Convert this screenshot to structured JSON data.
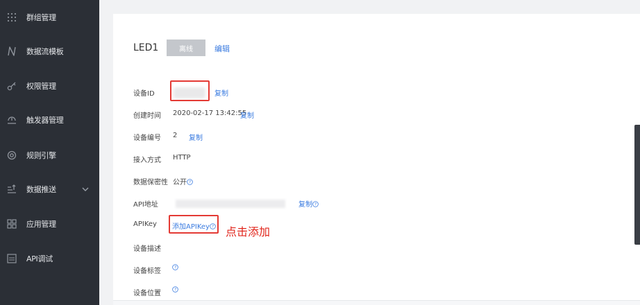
{
  "sidebar": {
    "items": [
      {
        "label": "群组管理",
        "icon": "grid-icon"
      },
      {
        "label": "数据流模板",
        "icon": "flow-n-icon"
      },
      {
        "label": "权限管理",
        "icon": "key-icon"
      },
      {
        "label": "触发器管理",
        "icon": "trigger-icon"
      },
      {
        "label": "规则引擎",
        "icon": "rule-engine-icon"
      },
      {
        "label": "数据推送",
        "icon": "push-icon",
        "has_dropdown": true
      },
      {
        "label": "应用管理",
        "icon": "apps-icon"
      },
      {
        "label": "API调试",
        "icon": "api-icon"
      }
    ]
  },
  "device": {
    "name": "LED1",
    "status": "离线",
    "edit_label": "编辑"
  },
  "fields": {
    "device_id": {
      "label": "设备ID",
      "value": "",
      "action": "复制"
    },
    "created_time": {
      "label": "创建时间",
      "value": "2020-02-17 13:42:55",
      "action": "复制"
    },
    "device_number": {
      "label": "设备编号",
      "value": "2",
      "action": "复制"
    },
    "access_method": {
      "label": "接入方式",
      "value": "HTTP"
    },
    "data_privacy": {
      "label": "数据保密性",
      "value": "公开"
    },
    "api_address": {
      "label": "API地址",
      "value": "",
      "action": "复制"
    },
    "api_key": {
      "label": "APIKey",
      "action": "添加APIKey"
    },
    "description": {
      "label": "设备描述"
    },
    "tags": {
      "label": "设备标签"
    },
    "location": {
      "label": "设备位置"
    }
  },
  "annotation": {
    "text": "点击添加"
  },
  "colors": {
    "sidebar_bg": "#2b2f36",
    "link": "#3a7be0",
    "highlight_red": "#e43a34"
  }
}
